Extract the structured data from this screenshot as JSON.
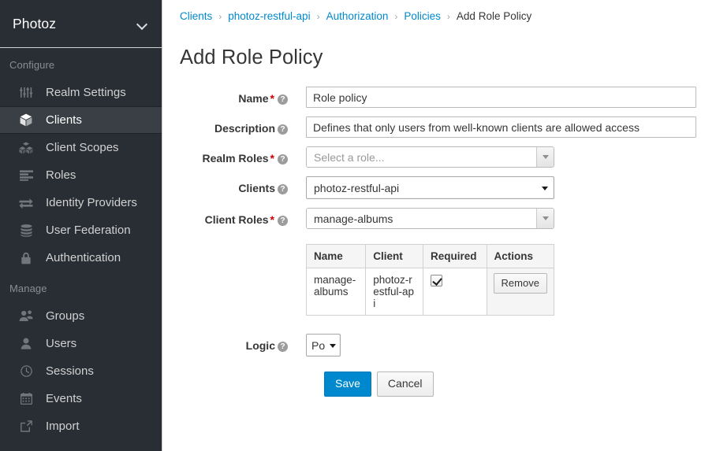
{
  "sidebar": {
    "realm": {
      "name": "Photoz",
      "chevron_icon": "chevron-down-icon"
    },
    "sections": [
      {
        "title": "Configure",
        "items": [
          {
            "label": "Realm Settings",
            "icon": "sliders-icon",
            "active": false
          },
          {
            "label": "Clients",
            "icon": "cube-icon",
            "active": true
          },
          {
            "label": "Client Scopes",
            "icon": "cubes-icon",
            "active": false
          },
          {
            "label": "Roles",
            "icon": "list-icon",
            "active": false
          },
          {
            "label": "Identity Providers",
            "icon": "exchange-arrows-icon",
            "active": false
          },
          {
            "label": "User Federation",
            "icon": "database-icon",
            "active": false
          },
          {
            "label": "Authentication",
            "icon": "lock-icon",
            "active": false
          }
        ]
      },
      {
        "title": "Manage",
        "items": [
          {
            "label": "Groups",
            "icon": "users-icon",
            "active": false
          },
          {
            "label": "Users",
            "icon": "user-icon",
            "active": false
          },
          {
            "label": "Sessions",
            "icon": "clock-icon",
            "active": false
          },
          {
            "label": "Events",
            "icon": "calendar-icon",
            "active": false
          },
          {
            "label": "Import",
            "icon": "import-arrow-icon",
            "active": false
          }
        ]
      }
    ]
  },
  "breadcrumb": {
    "separator": "›",
    "items": [
      {
        "label": "Clients",
        "link": true
      },
      {
        "label": "photoz-restful-api",
        "link": true
      },
      {
        "label": "Authorization",
        "link": true
      },
      {
        "label": "Policies",
        "link": true
      },
      {
        "label": "Add Role Policy",
        "link": false
      }
    ]
  },
  "page": {
    "title": "Add Role Policy"
  },
  "form": {
    "help_glyph": "?",
    "required_marker": "*",
    "name": {
      "label": "Name",
      "required": true,
      "value": "Role policy",
      "placeholder": ""
    },
    "description": {
      "label": "Description",
      "required": false,
      "value": "Defines that only users from well-known clients are allowed access",
      "placeholder": ""
    },
    "realm_roles": {
      "label": "Realm Roles",
      "required": true,
      "value": "",
      "placeholder": "Select a role..."
    },
    "clients": {
      "label": "Clients",
      "required": false,
      "value": "photoz-restful-api"
    },
    "client_roles": {
      "label": "Client Roles",
      "required": true,
      "value": "manage-albums",
      "placeholder": ""
    },
    "logic": {
      "label": "Logic",
      "required": false,
      "value": "Po"
    }
  },
  "roles_table": {
    "columns": [
      "Name",
      "Client",
      "Required",
      "Actions"
    ],
    "rows": [
      {
        "name": "manage-albums",
        "client": "photoz-restful-api",
        "required": true,
        "action_label": "Remove"
      }
    ]
  },
  "buttons": {
    "save": "Save",
    "cancel": "Cancel"
  },
  "colors": {
    "sidebar_bg": "#292e34",
    "sidebar_active_bg": "#393f44",
    "link_blue": "#0088ce",
    "primary_button": "#0088ce",
    "required_red": "#cc0000",
    "table_header_bg": "#f5f5f5"
  }
}
